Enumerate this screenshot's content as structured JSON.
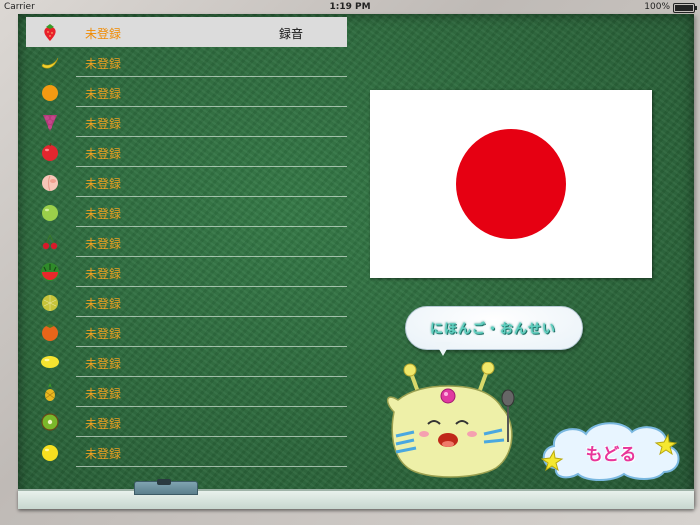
{
  "status_bar": {
    "carrier": "Carrier",
    "time": "1:19 PM",
    "battery": "100%"
  },
  "list": {
    "items": [
      {
        "icon": "strawberry-icon",
        "label": "未登録",
        "action": "録音",
        "selected": true
      },
      {
        "icon": "banana-icon",
        "label": "未登録"
      },
      {
        "icon": "orange-icon",
        "label": "未登録"
      },
      {
        "icon": "grapes-icon",
        "label": "未登録"
      },
      {
        "icon": "apple-icon",
        "label": "未登録"
      },
      {
        "icon": "peach-icon",
        "label": "未登録"
      },
      {
        "icon": "green-apple-icon",
        "label": "未登録"
      },
      {
        "icon": "cherry-icon",
        "label": "未登録"
      },
      {
        "icon": "watermelon-icon",
        "label": "未登録"
      },
      {
        "icon": "melon-icon",
        "label": "未登録"
      },
      {
        "icon": "persimmon-icon",
        "label": "未登録"
      },
      {
        "icon": "lemon-icon",
        "label": "未登録"
      },
      {
        "icon": "pineapple-icon",
        "label": "未登録"
      },
      {
        "icon": "kiwi-icon",
        "label": "未登録"
      },
      {
        "icon": "grapefruit-icon",
        "label": "未登録"
      }
    ]
  },
  "flag": {
    "name": "japan-flag",
    "field_color": "#ffffff",
    "disc_color": "#e60012"
  },
  "speech_bubble": {
    "text": "にほんご・おんせい"
  },
  "back_button": {
    "label": "もどる"
  },
  "colors": {
    "board": "#2e6b3e",
    "list_label": "#f0a020",
    "back_label": "#e8369a"
  }
}
